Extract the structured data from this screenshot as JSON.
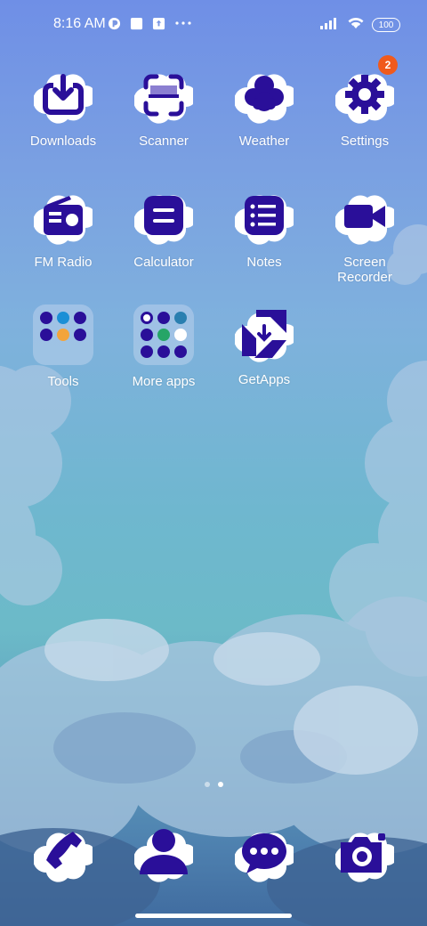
{
  "status_bar": {
    "time": "8:16 AM",
    "battery": "100",
    "icons": [
      "mi-icon",
      "square-notification-icon",
      "upload-notification-icon",
      "more-dots-icon",
      "signal-icon",
      "wifi-icon",
      "battery-icon"
    ]
  },
  "apps": {
    "row1": [
      {
        "label": "Downloads",
        "icon": "download-icon"
      },
      {
        "label": "Scanner",
        "icon": "scanner-icon"
      },
      {
        "label": "Weather",
        "icon": "cloud-icon"
      },
      {
        "label": "Settings",
        "icon": "gear-icon",
        "badge": "2"
      }
    ],
    "row2": [
      {
        "label": "FM Radio",
        "icon": "radio-icon"
      },
      {
        "label": "Calculator",
        "icon": "calculator-icon"
      },
      {
        "label": "Notes",
        "icon": "notes-list-icon"
      },
      {
        "label": "Screen\nRecorder",
        "icon": "video-camera-icon"
      }
    ],
    "row3": [
      {
        "label": "Tools",
        "icon": "folder-icon"
      },
      {
        "label": "More apps",
        "icon": "folder-icon"
      },
      {
        "label": "GetApps",
        "icon": "getapps-icon"
      }
    ]
  },
  "dock": [
    {
      "name": "Phone",
      "icon": "phone-icon"
    },
    {
      "name": "Contacts",
      "icon": "contacts-icon"
    },
    {
      "name": "Messaging",
      "icon": "message-icon"
    },
    {
      "name": "Camera",
      "icon": "camera-icon"
    }
  ],
  "pager": {
    "pages": 2,
    "active": 2
  },
  "colors": {
    "icon_fill": "#2a0f99",
    "cloud": "#ffffff",
    "badge": "#f05a1c"
  }
}
